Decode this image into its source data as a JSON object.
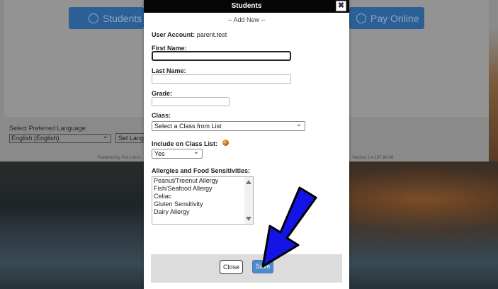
{
  "background": {
    "buttons": [
      {
        "label": "Students",
        "icon": "users-icon"
      },
      {
        "label": "Pay Online",
        "icon": "user-icon"
      }
    ],
    "language_label": "Select Preferred Language:",
    "language_value": "English (English)",
    "set_language_label": "Set Language",
    "powered_by": "Powered by Hot Lunch",
    "version": "Version 2.4.137.84.46"
  },
  "modal": {
    "title": "Students",
    "close_glyph": "✖",
    "subtitle": "-- Add New --",
    "user_account_label": "User Account:",
    "user_account_value": "parent.test",
    "first_name_label": "First Name:",
    "first_name_value": "",
    "last_name_label": "Last Name:",
    "last_name_value": "",
    "grade_label": "Grade:",
    "grade_value": "",
    "class_label": "Class:",
    "class_value": "Select a Class from List",
    "include_label": "Include on Class List:",
    "include_value": "Yes",
    "allergies_label": "Allergies and Food Sensitivities:",
    "allergies": [
      "Peanut/Treenut Allergy",
      "Fish/Seafood Allergy",
      "Celiac",
      "Gluten Sensitivity",
      "Dairy Allergy"
    ],
    "close_button": "Close",
    "save_button": "Save"
  },
  "colors": {
    "header_bg": "#060606",
    "save_bg": "#4d8bc9",
    "background_button": "#2c5f96",
    "annotation_arrow": "#1414e6"
  },
  "annotation": {
    "arrow_points_to": "save-button"
  }
}
